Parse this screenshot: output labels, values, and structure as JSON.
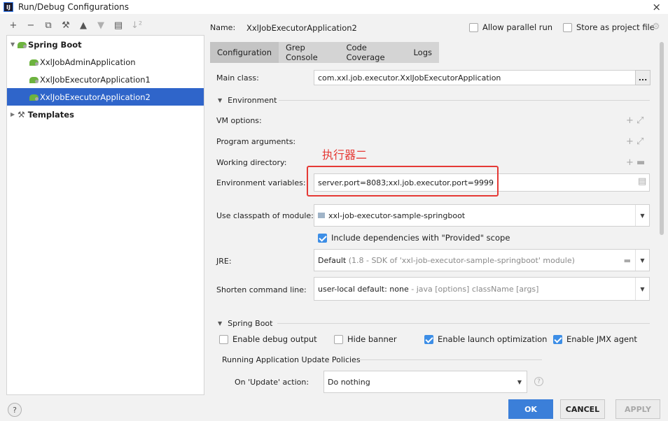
{
  "window": {
    "title": "Run/Debug Configurations",
    "close": "×"
  },
  "toolbar": {
    "add": "+",
    "remove": "−",
    "copy": "⧉",
    "edit": "🔧",
    "up": "▲",
    "down": "▼",
    "move": "▤",
    "sort": "↓²"
  },
  "tree": {
    "spring_boot": "Spring Boot",
    "items": [
      "XxlJobAdminApplication",
      "XxlJobExecutorApplication1",
      "XxlJobExecutorApplication2"
    ],
    "templates": "Templates"
  },
  "header": {
    "name_label": "Name:",
    "name_value": "XxlJobExecutorApplication2",
    "allow_parallel": "Allow parallel run",
    "store_project": "Store as project file"
  },
  "tabs": [
    "Configuration",
    "Grep Console",
    "Code Coverage",
    "Logs"
  ],
  "form": {
    "main_class_label": "Main class:",
    "main_class_value": "com.xxl.job.executor.XxlJobExecutorApplication",
    "dots": "...",
    "environment_title": "Environment",
    "vm_options_label": "VM options:",
    "program_args_label": "Program arguments:",
    "working_dir_label": "Working directory:",
    "env_vars_label": "Environment variables:",
    "env_vars_value": "server.port=8083;xxl.job.executor.port=9999",
    "annotation": "执行器二",
    "classpath_label": "Use classpath of module:",
    "classpath_value": "xxl-job-executor-sample-springboot",
    "include_deps": "Include dependencies with \"Provided\" scope",
    "jre_label": "JRE:",
    "jre_value": "Default",
    "jre_detail": "(1.8 - SDK of 'xxl-job-executor-sample-springboot' module)",
    "shorten_label": "Shorten command line:",
    "shorten_value": "user-local default: none",
    "shorten_detail": "- java [options] className [args]",
    "spring_boot_title": "Spring Boot",
    "debug_output": "Enable debug output",
    "hide_banner": "Hide banner",
    "launch_opt": "Enable launch optimization",
    "jmx_agent": "Enable JMX agent",
    "update_policies": "Running Application Update Policies",
    "update_action_label": "On 'Update' action:",
    "update_action_value": "Do nothing"
  },
  "checkbox_state": {
    "allow_parallel": false,
    "store_project": false,
    "include_deps": true,
    "debug_output": false,
    "hide_banner": false,
    "launch_opt": true,
    "jmx_agent": true
  },
  "buttons": {
    "ok": "OK",
    "cancel": "CANCEL",
    "apply": "APPLY",
    "help": "?"
  },
  "colors": {
    "selection": "#2f65ca",
    "ok_button": "#3b7fd9",
    "annotation_red": "#e53935",
    "checkbox_blue": "#3d8ee6"
  }
}
